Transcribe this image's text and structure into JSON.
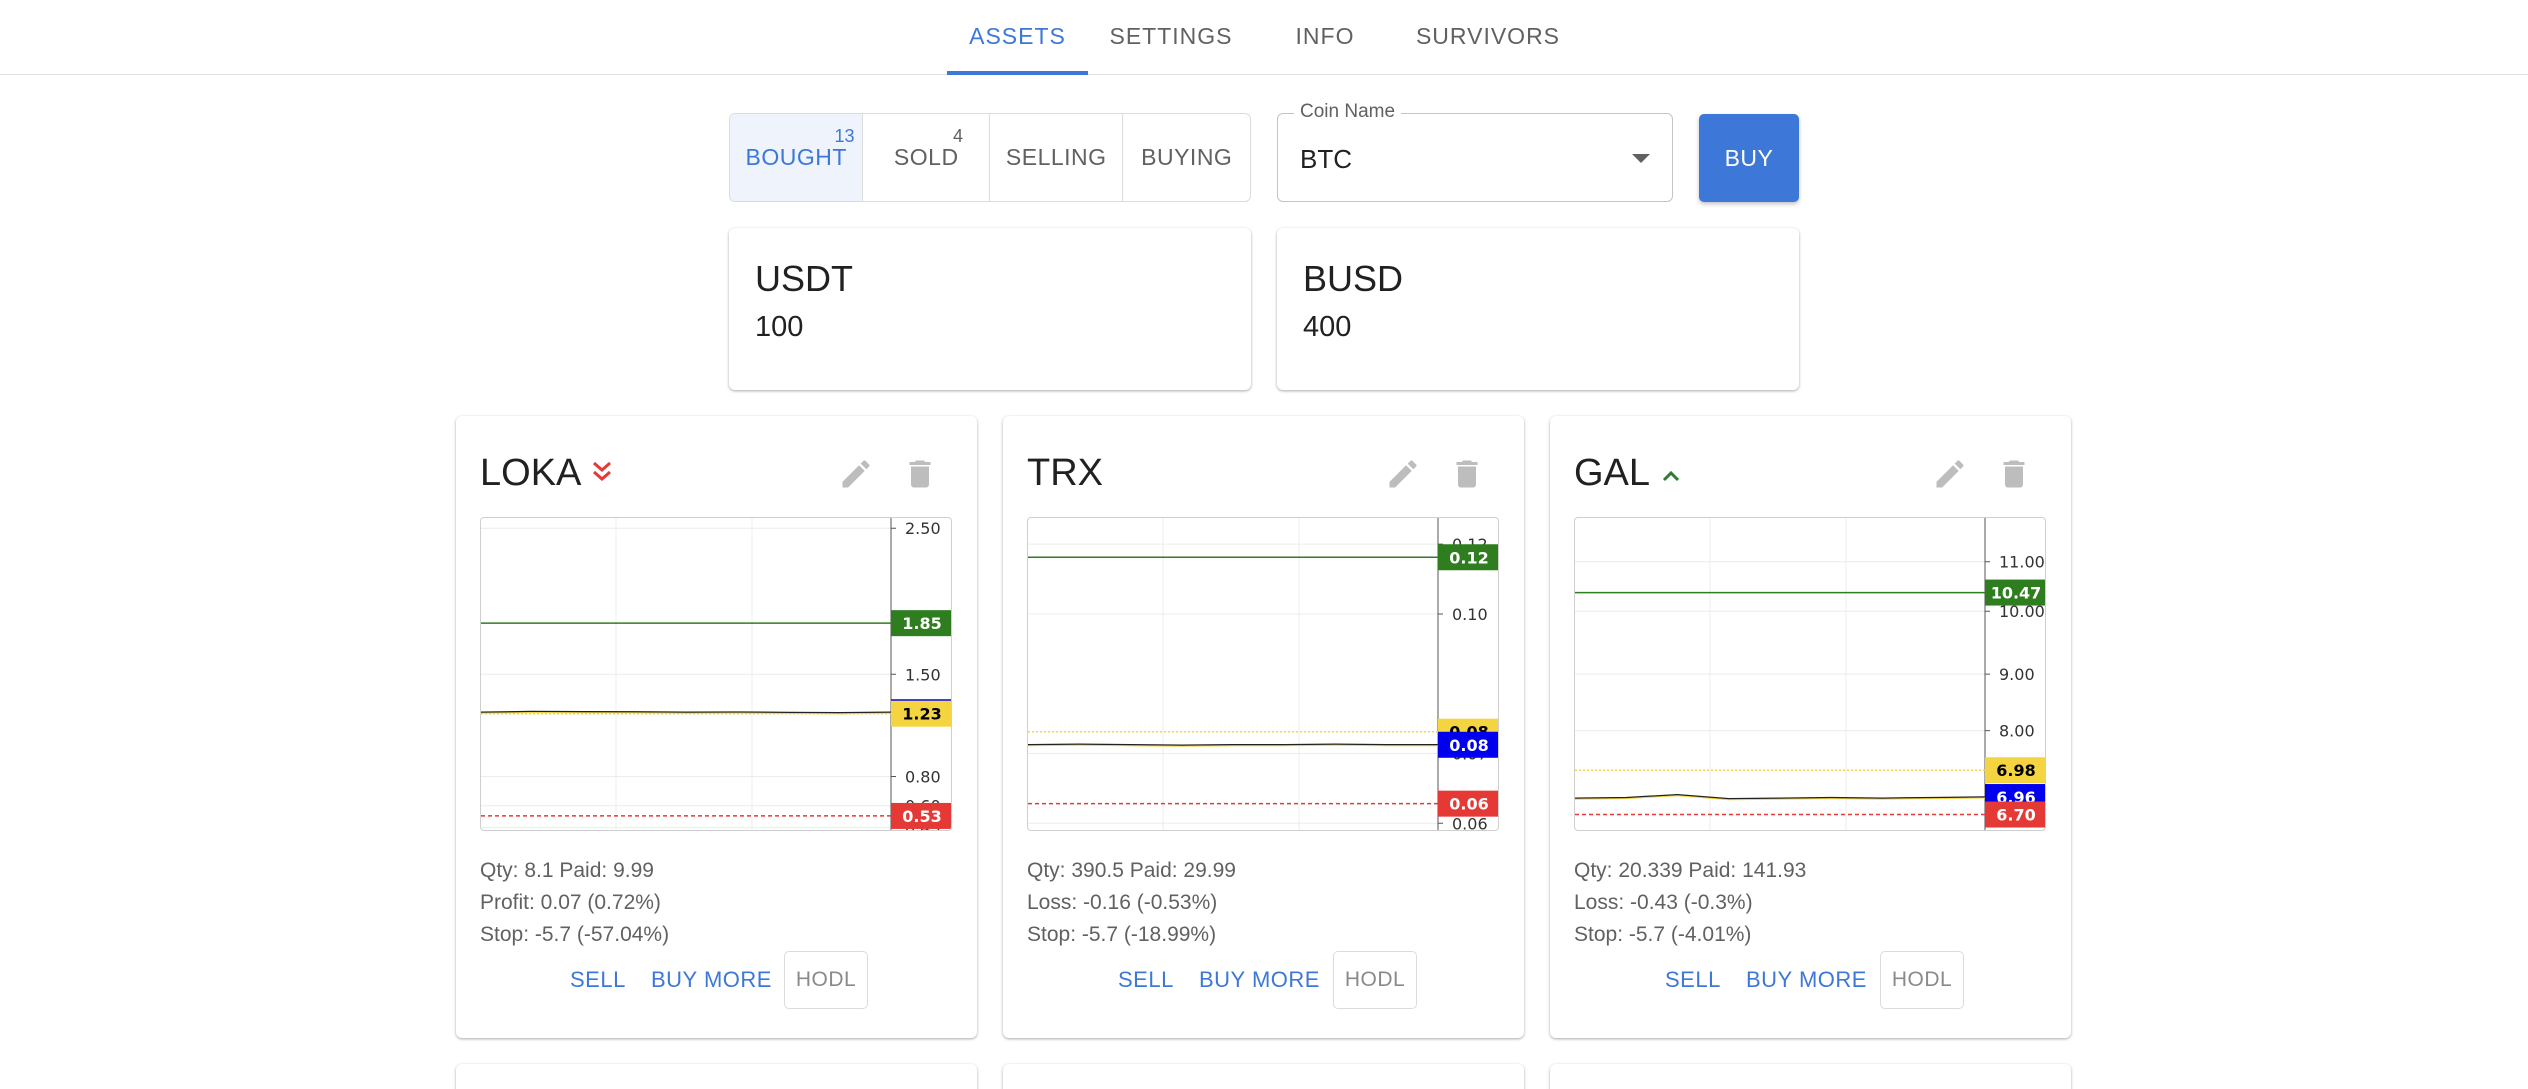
{
  "tabs": [
    {
      "label": "ASSETS",
      "active": true
    },
    {
      "label": "SETTINGS",
      "active": false
    },
    {
      "label": "INFO",
      "active": false
    },
    {
      "label": "SURVIVORS",
      "active": false
    }
  ],
  "filters": [
    {
      "label": "BOUGHT",
      "count": "13",
      "active": true
    },
    {
      "label": "SOLD",
      "count": "4",
      "active": false
    },
    {
      "label": "SELLING",
      "count": "",
      "active": false
    },
    {
      "label": "BUYING",
      "count": "",
      "active": false
    }
  ],
  "coin_select": {
    "label": "Coin Name",
    "value": "BTC",
    "icon": "chevron-down-icon"
  },
  "buy_button": "BUY",
  "balances": [
    {
      "currency": "USDT",
      "amount": "100"
    },
    {
      "currency": "BUSD",
      "amount": "400"
    }
  ],
  "colors": {
    "accent": "#3d78d8",
    "profit_line": "#2e7d1f",
    "current_price": "#0000ee",
    "paid_price": "#f5d442",
    "stop_line": "#e53935",
    "trend_down": "#e53935",
    "trend_up": "#2e7d32"
  },
  "coins": [
    {
      "name": "LOKA",
      "trend": "down",
      "trend_icon": "double-chevron-down-icon",
      "edit_icon": "pencil-icon",
      "delete_icon": "trash-icon",
      "qty_line": "Qty: 8.1 Paid: 9.99",
      "pl_line": "Profit: 0.07 (0.72%)",
      "stop_line": "Stop: -5.7 (-57.04%)",
      "sell_label": "SELL",
      "buy_more_label": "BUY MORE",
      "hodl_label": "HODL",
      "chart": {
        "ymin": 0.42,
        "ymax": 2.57,
        "ticks": [
          "2.50",
          "1.50",
          "0.80",
          "0.60",
          "0.45"
        ],
        "tick_values": [
          2.5,
          1.5,
          0.8,
          0.6,
          0.45
        ],
        "price_series": [
          1.24,
          1.245,
          1.243,
          1.242,
          1.24,
          1.241,
          1.238,
          1.236,
          1.24
        ],
        "markers": [
          {
            "label": "1.85",
            "value": 1.85,
            "kind": "profit"
          },
          {
            "label": "1.24",
            "value": 1.24,
            "kind": "current"
          },
          {
            "label": "1.23",
            "value": 1.23,
            "kind": "paid"
          },
          {
            "label": "0.53",
            "value": 0.53,
            "kind": "stop"
          }
        ]
      }
    },
    {
      "name": "TRX",
      "trend": "none",
      "trend_icon": "",
      "edit_icon": "pencil-icon",
      "delete_icon": "trash-icon",
      "qty_line": "Qty: 390.5 Paid: 29.99",
      "pl_line": "Loss: -0.16 (-0.53%)",
      "stop_line": "Stop: -5.7 (-18.99%)",
      "sell_label": "SELL",
      "buy_more_label": "BUY MORE",
      "hodl_label": "HODL",
      "chart": {
        "ymin": 0.057,
        "ymax": 0.129,
        "ticks": [
          "0.12",
          "0.10",
          "0.07",
          "0.06"
        ],
        "tick_values": [
          0.123,
          0.107,
          0.075,
          0.059
        ],
        "price_series": [
          0.077,
          0.0771,
          0.077,
          0.0769,
          0.077,
          0.077,
          0.0771,
          0.077,
          0.077
        ],
        "markers": [
          {
            "label": "0.12",
            "value": 0.12,
            "kind": "profit"
          },
          {
            "label": "0.08",
            "value": 0.08,
            "kind": "paid"
          },
          {
            "label": "0.08",
            "value": 0.077,
            "kind": "current"
          },
          {
            "label": "0.06",
            "value": 0.0635,
            "kind": "stop"
          }
        ]
      }
    },
    {
      "name": "GAL",
      "trend": "up",
      "trend_icon": "chevron-up-icon",
      "edit_icon": "pencil-icon",
      "delete_icon": "trash-icon",
      "qty_line": "Qty: 20.339 Paid: 141.93",
      "pl_line": "Loss: -0.43 (-0.3%)",
      "stop_line": "Stop: -5.7 (-4.01%)",
      "sell_label": "SELL",
      "buy_more_label": "BUY MORE",
      "hodl_label": "HODL",
      "chart": {
        "ymin": 6.36,
        "ymax": 11.75,
        "ticks": [
          "11.00",
          "10.00",
          "9.00",
          "8.00"
        ],
        "tick_values": [
          11.0,
          10.15,
          9.07,
          8.1
        ],
        "price_series": [
          6.94,
          6.95,
          7.0,
          6.93,
          6.94,
          6.95,
          6.94,
          6.95,
          6.96
        ],
        "markers": [
          {
            "label": "10.47",
            "value": 10.47,
            "kind": "profit"
          },
          {
            "label": "6.98",
            "value": 7.42,
            "kind": "paid"
          },
          {
            "label": "6.96",
            "value": 6.96,
            "kind": "current"
          },
          {
            "label": "6.70",
            "value": 6.66,
            "kind": "stop"
          }
        ]
      }
    }
  ]
}
